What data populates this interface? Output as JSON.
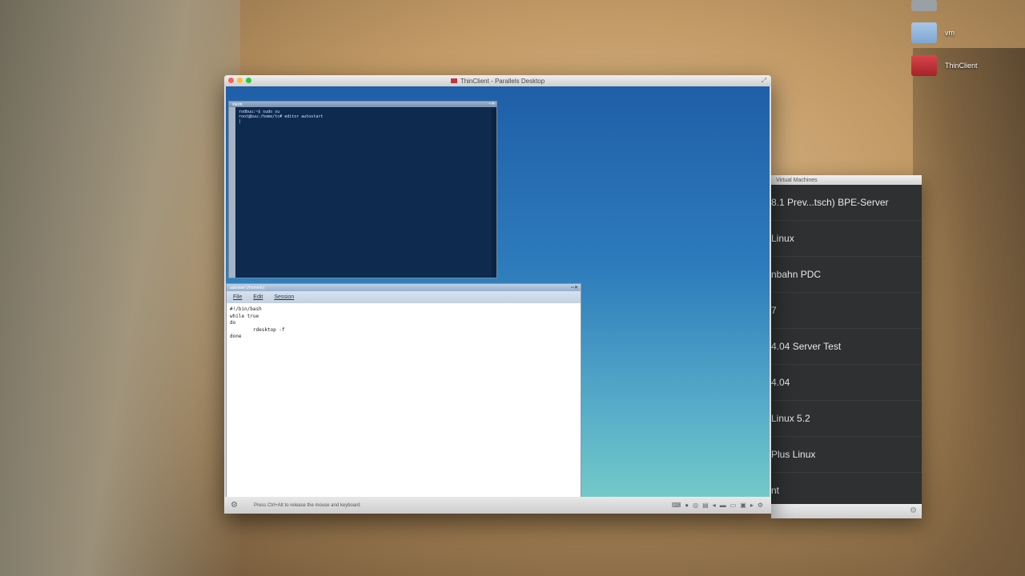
{
  "desktop": {
    "icons": [
      {
        "label": "",
        "color": "#9aa0a6"
      },
      {
        "label": "vm",
        "color": "#8fb3d9"
      },
      {
        "label": "ThinClient",
        "color": "#c8323a"
      }
    ]
  },
  "parallels_window": {
    "title": "ThinClient - Parallels Desktop",
    "status_hint": "Press Ctrl+Alt to release the mouse and keyboard"
  },
  "xterm": {
    "title": "xterm",
    "lines": [
      "rodbuu:~$ sudo su",
      "root@buu:/home/tc# editor autostart",
      "|"
    ]
  },
  "editor": {
    "title": "autostart (/home/tc)",
    "menu": [
      "File",
      "Edit",
      "Session"
    ],
    "lines": [
      "#!/bin/bash",
      "while true",
      "do",
      "        rdesktop -f",
      "done"
    ]
  },
  "vm_list": {
    "title": "Virtual Machines",
    "items": [
      "8.1 Prev...tsch) BPE-Server",
      "Linux",
      "nbahn PDC",
      "7",
      "4.04 Server Test",
      "4.04",
      "Linux 5.2",
      "Plus Linux",
      "nt"
    ]
  },
  "colors": {
    "vm_screen_top": "#1f5fa8",
    "vm_screen_bottom": "#73c9c8",
    "close_red": "#ff5f57",
    "min_yellow": "#ffbd2e",
    "zoom_green": "#28c840"
  }
}
